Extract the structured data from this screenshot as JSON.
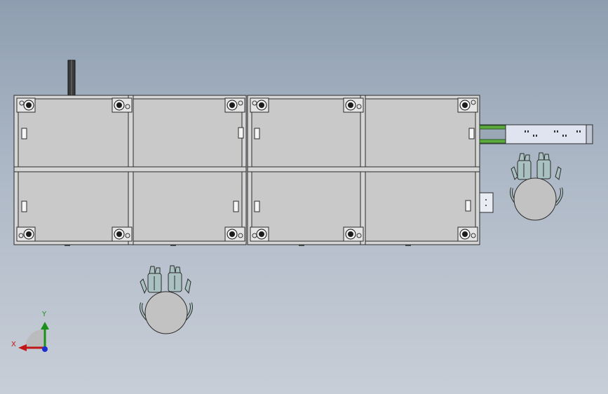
{
  "scene": {
    "background_top": "#8e9eb0",
    "background_bottom": "#c8ced7",
    "panel_fill": "#c9c9c9",
    "frame_fill": "#d6d6d6",
    "edge_color": "#2b2b2b",
    "conveyor_fill": "#dfe4f0",
    "rail_color": "#5cab3c",
    "operator_fill": "#c2c2c2",
    "hand_fill": "#a9c1c0"
  },
  "triad": {
    "x_label": "X",
    "y_label": "Y",
    "x_color": "#c01818",
    "y_color": "#1a8f1a",
    "z_color": "#1a2fd0"
  },
  "model": {
    "modules": [
      "workbench-module-1",
      "workbench-module-2"
    ],
    "operators": [
      "operator-bottom",
      "operator-right"
    ],
    "conveyor": "side-conveyor"
  }
}
